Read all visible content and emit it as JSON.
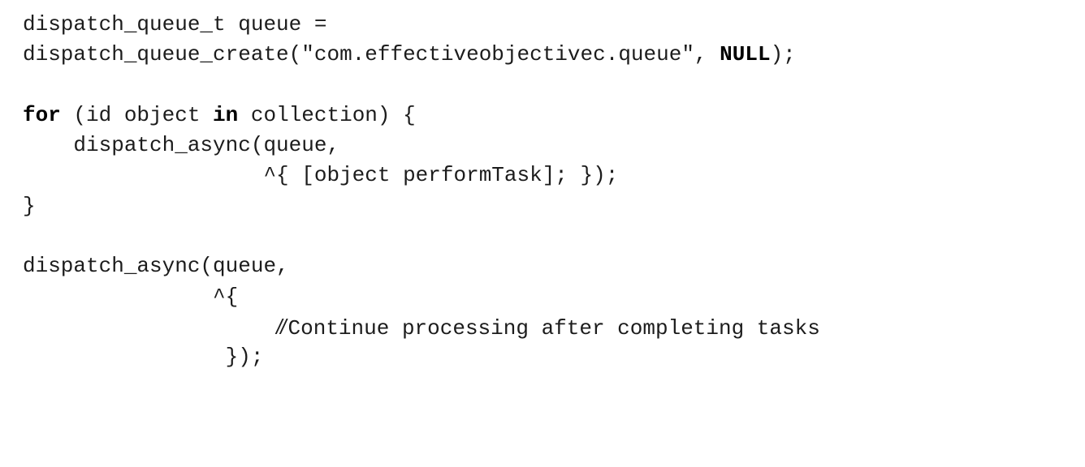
{
  "code": {
    "lines": {
      "l1": {
        "text": "dispatch_queue_t queue ="
      },
      "l2": {
        "pre": "dispatch_queue_create(\"com.effectiveobjectivec.queue\", ",
        "kw": "NULL",
        "post": ");"
      },
      "l3": {
        "text": ""
      },
      "l4": {
        "kw1": "for",
        "mid": " (id object ",
        "kw2": "in",
        "post": " collection) {"
      },
      "l5": {
        "text": "    dispatch_async(queue,"
      },
      "l6": {
        "text": "                   ^{ [object performTask]; });"
      },
      "l7": {
        "text": "}"
      },
      "l8": {
        "text": ""
      },
      "l9": {
        "text": "dispatch_async(queue,"
      },
      "l10": {
        "text": "               ^{"
      },
      "l11": {
        "indent": "                    ",
        "slashes": "//",
        "comment": "Continue processing after completing tasks"
      },
      "l12": {
        "text": "                });"
      }
    }
  }
}
